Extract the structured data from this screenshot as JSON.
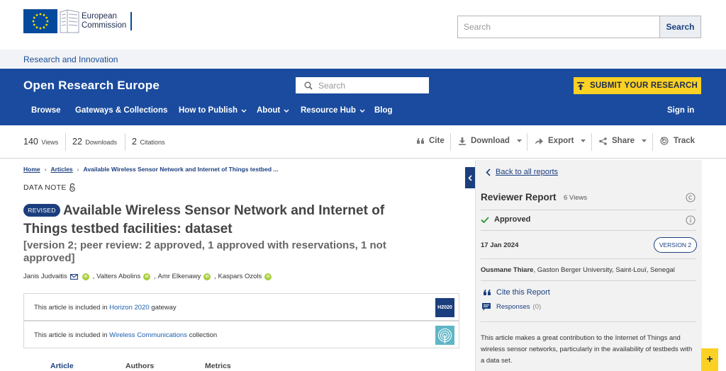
{
  "ec_header": {
    "logo_line1": "European",
    "logo_line2": "Commission",
    "search_placeholder": "Search",
    "search_button": "Search"
  },
  "ri_strip": {
    "link": "Research and Innovation"
  },
  "ore": {
    "title": "Open Research Europe",
    "search_placeholder": "Search",
    "submit_label": "SUBMIT YOUR RESEARCH",
    "nav": [
      {
        "label": "Browse",
        "has_dropdown": false
      },
      {
        "label": "Gateways & Collections",
        "has_dropdown": false
      },
      {
        "label": "How to Publish",
        "has_dropdown": true
      },
      {
        "label": "About",
        "has_dropdown": true
      },
      {
        "label": "Resource Hub",
        "has_dropdown": true
      },
      {
        "label": "Blog",
        "has_dropdown": false
      }
    ],
    "sign_in": "Sign in"
  },
  "metrics": {
    "views_count": "140",
    "views_label": "Views",
    "downloads_count": "22",
    "downloads_label": "Downloads",
    "citations_count": "2",
    "citations_label": "Citations"
  },
  "actions": {
    "cite": "Cite",
    "download": "Download",
    "export": "Export",
    "share": "Share",
    "track": "Track"
  },
  "breadcrumb": {
    "home": "Home",
    "articles": "Articles",
    "current": "Available Wireless Sensor Network and Internet of Things testbed ..."
  },
  "article": {
    "type": "DATA NOTE",
    "badge": "REVISED",
    "title": "Available Wireless Sensor Network and Internet of Things testbed facilities: dataset",
    "version_note": "[version 2; peer review: 2 approved, 1 approved with reservations, 1 not approved]",
    "authors": [
      "Janis Judvaitis",
      "Valters Abolins",
      "Amr Elkenawy",
      "Kaspars Ozols"
    ],
    "orcid_label": "iD",
    "gateway": {
      "prefix": "This article is included in ",
      "name": "Horizon 2020",
      "suffix": " gateway",
      "badge": "H2020"
    },
    "collection": {
      "prefix": "This article is included in ",
      "name": "Wireless Communications",
      "suffix": " collection"
    },
    "tabs": [
      "Article",
      "Authors",
      "Metrics"
    ]
  },
  "review_panel": {
    "back_link": "Back to all reports",
    "title": "Reviewer Report",
    "views": "6 Views",
    "status": "Approved",
    "date": "17 Jan 2024",
    "version": "VERSION 2",
    "reviewer_name": "Ousmane Thiare",
    "reviewer_affiliation": ", Gaston Berger University, Saint-Louï, Senegal",
    "cite_label": "Cite this Report",
    "responses_label": "Responses",
    "responses_count": "(0)",
    "body": "This article makes a great contribution to the Internet of Things and wireless sensor networks, particularly in the availability of testbeds with a data set."
  },
  "floating": {
    "plus": "+"
  },
  "colors": {
    "ore_blue": "#1a4b9e",
    "accent_yellow": "#fbd123",
    "ec_blue": "#044a9c",
    "orcid_green": "#a6ce39",
    "approved_green": "#3a9a3a"
  },
  "icons": {
    "search": "search-icon",
    "upload": "upload-icon",
    "chevron": "chevron-down-icon",
    "quote": "quote-icon",
    "download": "download-icon",
    "export": "export-arrow-icon",
    "share": "share-icon",
    "track": "track-icon",
    "open_access": "open-access-lock-icon",
    "mail": "mail-icon",
    "check": "check-icon",
    "info": "info-icon",
    "cc": "creative-commons-icon",
    "comment": "comment-icon"
  }
}
